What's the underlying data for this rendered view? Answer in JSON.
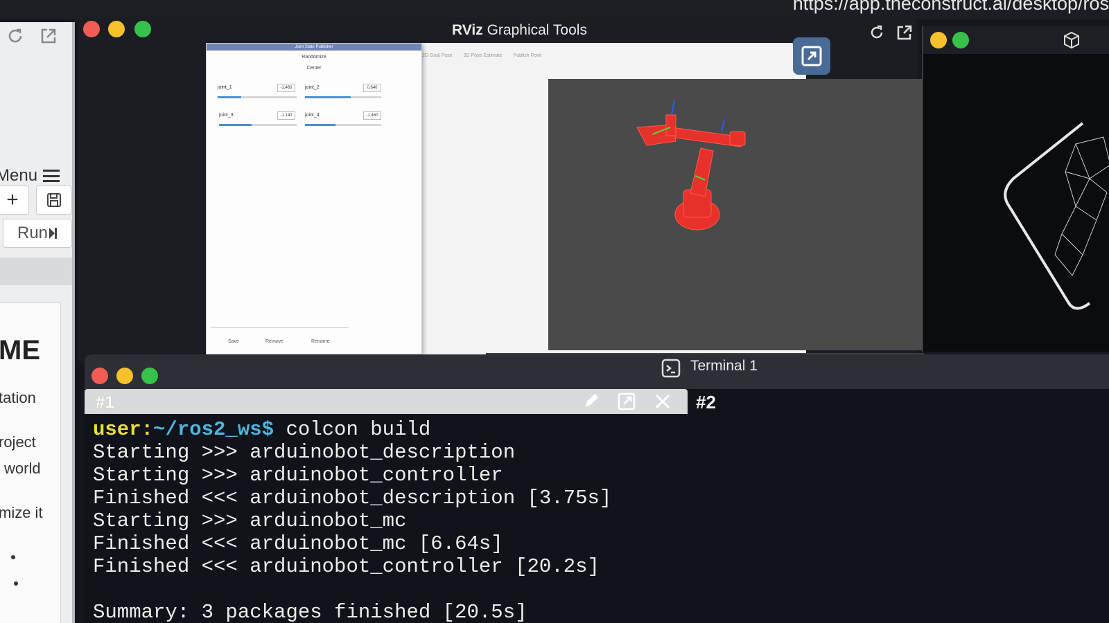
{
  "browser": {
    "url": "https://app.theconstruct.ai/desktop/ros"
  },
  "left_panel": {
    "menu_label": "Menu",
    "plus_label": "+",
    "run_label": "Run",
    "doc_heading": "ME",
    "doc_lines": [
      "tation",
      "roject",
      "world",
      "mize it"
    ]
  },
  "graphical_tools": {
    "title": "Graphical Tools",
    "logo_text": "RViz"
  },
  "joint_state_publisher": {
    "title": "Joint State Publisher",
    "randomize_label": "Randomize",
    "center_label": "Center",
    "joints": [
      {
        "name": "joint_1",
        "value": "-1.460",
        "fill": 0.3
      },
      {
        "name": "joint_2",
        "value": "0.640",
        "fill": 0.6
      },
      {
        "name": "joint_3",
        "value": "-1.140",
        "fill": 0.3
      },
      {
        "name": "joint_4",
        "value": "-1.460",
        "fill": 0.4
      }
    ],
    "bottom_buttons": [
      "Save",
      "Remove",
      "Rename"
    ]
  },
  "rviz": {
    "toolbar": [
      "2D Goal Pose",
      "2D Pose Estimate",
      "Publish Point"
    ]
  },
  "terminal": {
    "title": "Terminal 1",
    "tab1": "#1",
    "tab2": "#2",
    "prompt_user": "user:",
    "prompt_path": "~/ros2_ws$",
    "command": " colcon build",
    "lines": [
      "Starting >>> arduinobot_description",
      "Starting >>> arduinobot_controller",
      "Finished <<< arduinobot_description [3.75s]",
      "Starting >>> arduinobot_mc",
      "Finished <<< arduinobot_mc [6.64s]",
      "Finished <<< arduinobot_controller [20.2s]",
      "",
      "Summary: 3 packages finished [20.5s]"
    ]
  },
  "colors": {
    "traffic_red": "#f25c54",
    "traffic_yellow": "#f6c12b",
    "traffic_green": "#36c24a",
    "prompt_user": "#e9df38",
    "prompt_path": "#4fb5df",
    "robot": "#e8312a"
  }
}
